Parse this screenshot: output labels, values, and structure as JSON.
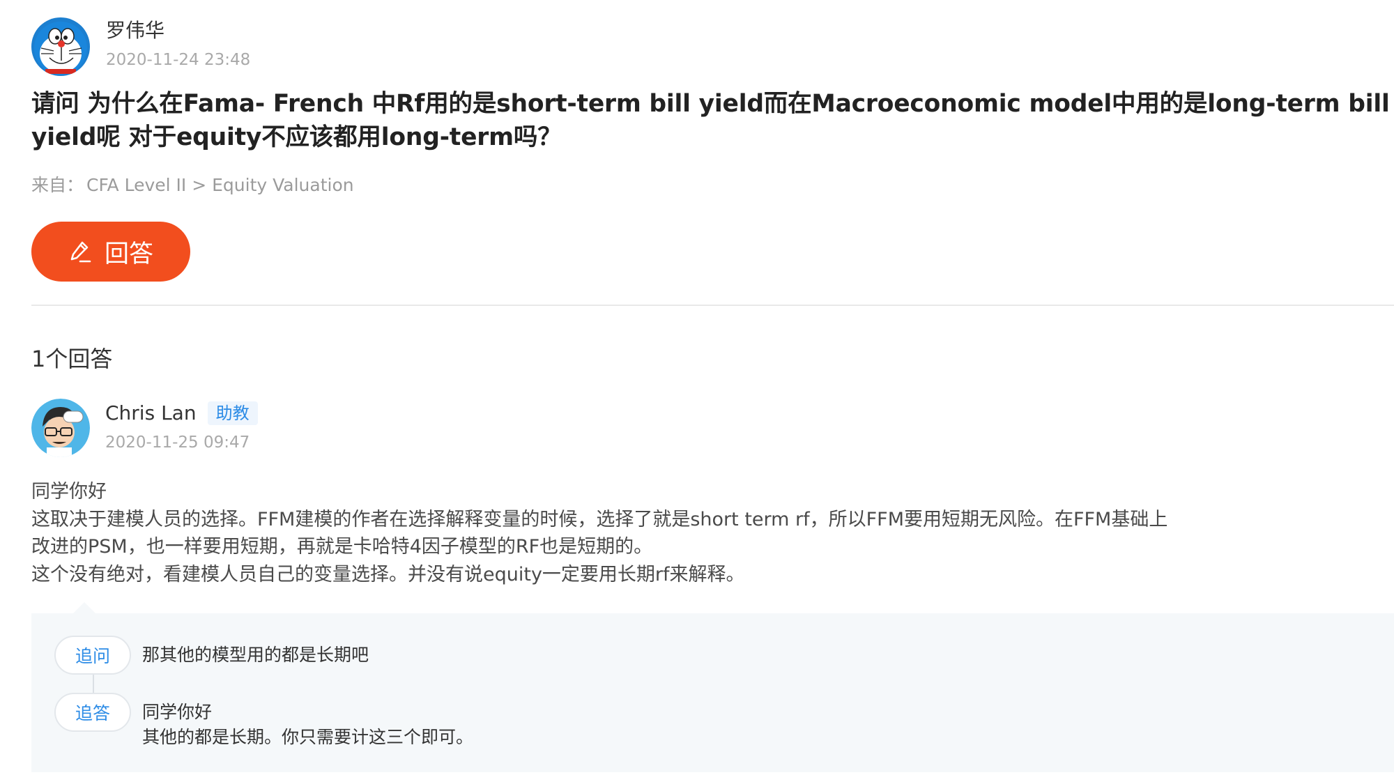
{
  "question": {
    "author": {
      "name": "罗伟华",
      "time": "2020-11-24 23:48",
      "avatar_icon": "doraemon-avatar"
    },
    "title": "请问 为什么在Fama- French 中Rf用的是short-term bill yield而在Macroeconomic model中用的是long-term bill yield呢 对于equity不应该都用long-term吗？",
    "source_prefix": "来自：",
    "source_path": "CFA Level II > Equity Valuation",
    "answer_button_label": "回答",
    "answer_button_icon": "pencil-icon"
  },
  "answers_header": "1个回答",
  "answer": {
    "author": {
      "name": "Chris Lan",
      "role": "助教",
      "time": "2020-11-25 09:47",
      "avatar_icon": "cartoon-man-avatar"
    },
    "body": [
      "同学你好",
      "这取决于建模人员的选择。FFM建模的作者在选择解释变量的时候，选择了就是short term rf，所以FFM要用短期无风险。在FFM基础上",
      "改进的PSM，也一样要用短期，再就是卡哈特4因子模型的RF也是短期的。",
      "这个没有绝对，看建模人员自己的变量选择。并没有说equity一定要用长期rf来解释。"
    ]
  },
  "followups": [
    {
      "tag": "追问",
      "lines": [
        "那其他的模型用的都是长期吧"
      ]
    },
    {
      "tag": "追答",
      "lines": [
        "同学你好",
        "其他的都是长期。你只需要计这三个即可。"
      ]
    }
  ],
  "colors": {
    "accent_orange": "#f24e1e",
    "badge_blue": "#2d8ce6",
    "followup_bg": "#f5f8fa"
  }
}
